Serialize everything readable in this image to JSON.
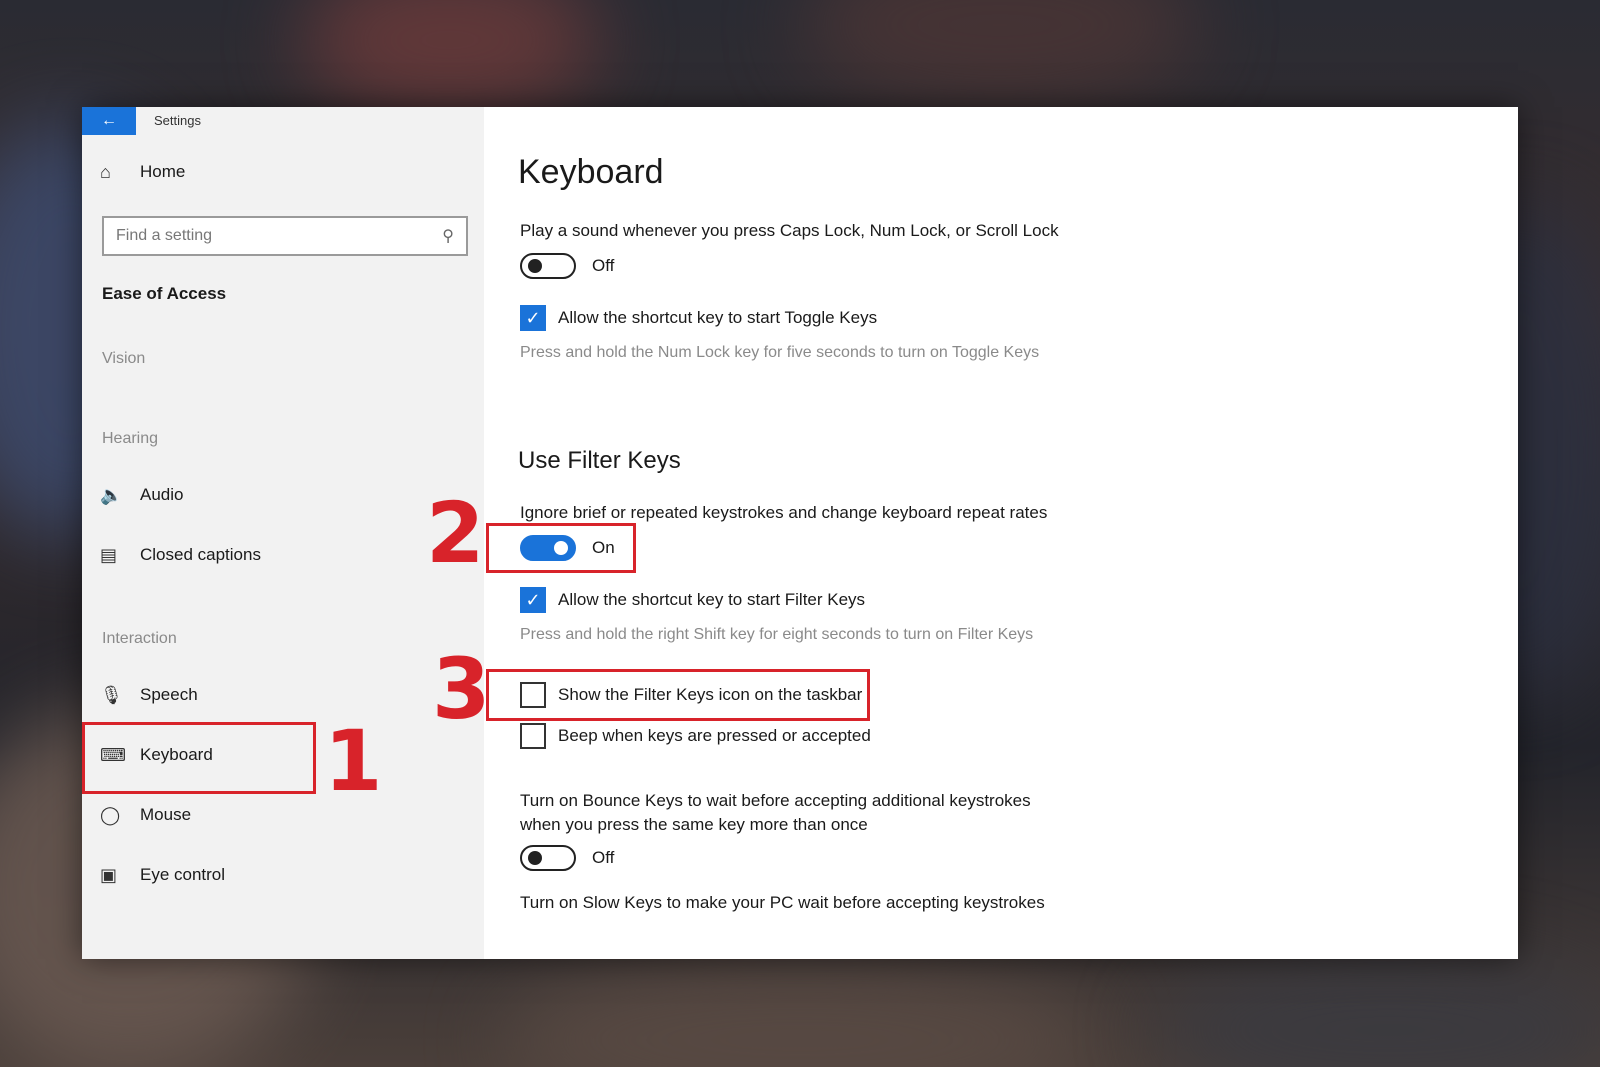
{
  "window": {
    "title": "Settings",
    "back_icon": "arrow-left-icon",
    "accent": "#1a73d9"
  },
  "sidebar": {
    "home_label": "Home",
    "search_placeholder": "Find a setting",
    "section": "Ease of Access",
    "groups": {
      "vision": "Vision",
      "hearing": "Hearing",
      "interaction": "Interaction"
    },
    "items": [
      {
        "label": "Audio",
        "icon": "speaker-icon"
      },
      {
        "label": "Closed captions",
        "icon": "captions-icon"
      },
      {
        "label": "Speech",
        "icon": "microphone-icon"
      },
      {
        "label": "Keyboard",
        "icon": "keyboard-icon"
      },
      {
        "label": "Mouse",
        "icon": "mouse-icon"
      },
      {
        "label": "Eye control",
        "icon": "eye-control-icon"
      }
    ]
  },
  "main": {
    "title": "Keyboard",
    "toggle_keys_sound": "Play a sound whenever you press Caps Lock, Num Lock, or Scroll Lock",
    "toggle_keys_state": "Off",
    "toggle_keys_shortcut": "Allow the shortcut key to start Toggle Keys",
    "toggle_keys_desc": "Press and hold the Num Lock key for five seconds to turn on Toggle Keys",
    "filter_heading": "Use Filter Keys",
    "filter_desc": "Ignore brief or repeated keystrokes and change keyboard repeat rates",
    "filter_state": "On",
    "filter_shortcut": "Allow the shortcut key to start Filter Keys",
    "filter_shortcut_desc": "Press and hold the right Shift key for eight seconds to turn on Filter Keys",
    "show_icon": "Show the Filter Keys icon on the taskbar",
    "beep": "Beep when keys are pressed or accepted",
    "bounce_desc": "Turn on Bounce Keys to wait before accepting additional keystrokes when you press the same key more than once",
    "bounce_state": "Off",
    "slow_desc": "Turn on Slow Keys to make your PC wait before accepting keystrokes"
  },
  "annotations": {
    "n1": "1",
    "n2": "2",
    "n3": "3",
    "color": "#d8232a"
  }
}
